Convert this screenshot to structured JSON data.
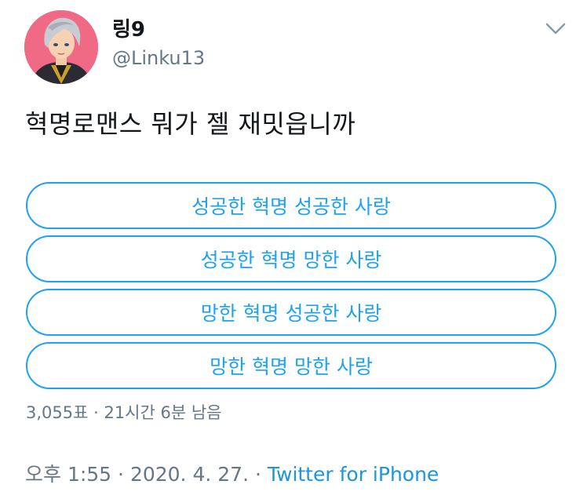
{
  "author": {
    "display_name": "링9",
    "handle": "@Linku13"
  },
  "tweet": {
    "text": "혁명로맨스 뭐가 젤 재밋읍니까"
  },
  "poll": {
    "options": [
      {
        "label": "성공한 혁명 성공한 사랑"
      },
      {
        "label": "성공한 혁명 망한 사랑"
      },
      {
        "label": "망한 혁명 성공한 사랑"
      },
      {
        "label": "망한 혁명 망한 사랑"
      }
    ],
    "meta": "3,055표 · 21시간 6분 남음"
  },
  "footer": {
    "time": "오후 1:55",
    "separator1": " · ",
    "date": "2020. 4. 27.",
    "separator2": " · ",
    "source": "Twitter for iPhone"
  },
  "icons": {
    "avatar": "anime-portrait-avatar",
    "menu": "chevron-down-icon"
  },
  "colors": {
    "accent": "#1da1f2",
    "source_link": "#1b95e0",
    "secondary_text": "#657786",
    "primary_text": "#14171a",
    "avatar_background": "#f06a86"
  }
}
